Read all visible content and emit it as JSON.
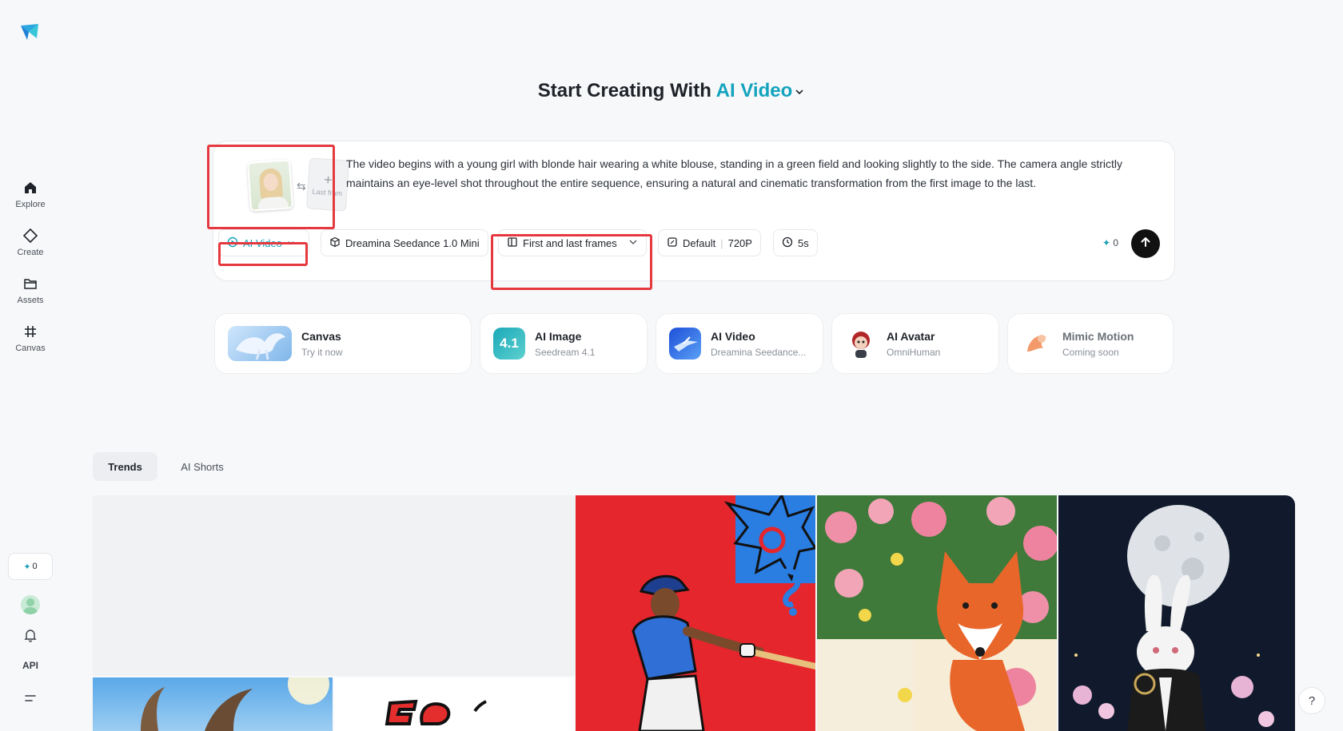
{
  "sidebar": {
    "items": [
      {
        "label": "Explore",
        "icon": "home-icon"
      },
      {
        "label": "Create",
        "icon": "diamond-icon"
      },
      {
        "label": "Assets",
        "icon": "folder-icon"
      },
      {
        "label": "Canvas",
        "icon": "frame-icon"
      }
    ],
    "credits": "0",
    "api_label": "API"
  },
  "headline": {
    "prefix": "Start Creating With",
    "mode": "AI Video"
  },
  "prompt": {
    "text": "The video begins with a young girl with blonde hair wearing a white blouse, standing in a green field and looking slightly to the side. The camera angle strictly maintains an eye-level shot throughout the entire sequence, ensuring a natural and cinematic transformation from the first image to the last.",
    "last_frame_label": "Last fram",
    "swap_glyph": "⇆",
    "plus_glyph": "+"
  },
  "toolbar": {
    "mode_label": "AI Video",
    "model_label": "Dreamina Seedance 1.0 Mini",
    "frames_label": "First and last frames",
    "ratio_label": "Default",
    "resolution_label": "720P",
    "duration_label": "5s",
    "cost": "0"
  },
  "tools": [
    {
      "title": "Canvas",
      "subtitle": "Try it now"
    },
    {
      "title": "AI Image",
      "subtitle": "Seedream 4.1",
      "badge": "4.1"
    },
    {
      "title": "AI Video",
      "subtitle": "Dreamina Seedance..."
    },
    {
      "title": "AI Avatar",
      "subtitle": "OmniHuman"
    },
    {
      "title": "Mimic Motion",
      "subtitle": "Coming soon"
    }
  ],
  "tabs": {
    "trends": "Trends",
    "shorts": "AI Shorts"
  },
  "colors": {
    "accent": "#12a3bd",
    "annotation": "#e5393f"
  }
}
